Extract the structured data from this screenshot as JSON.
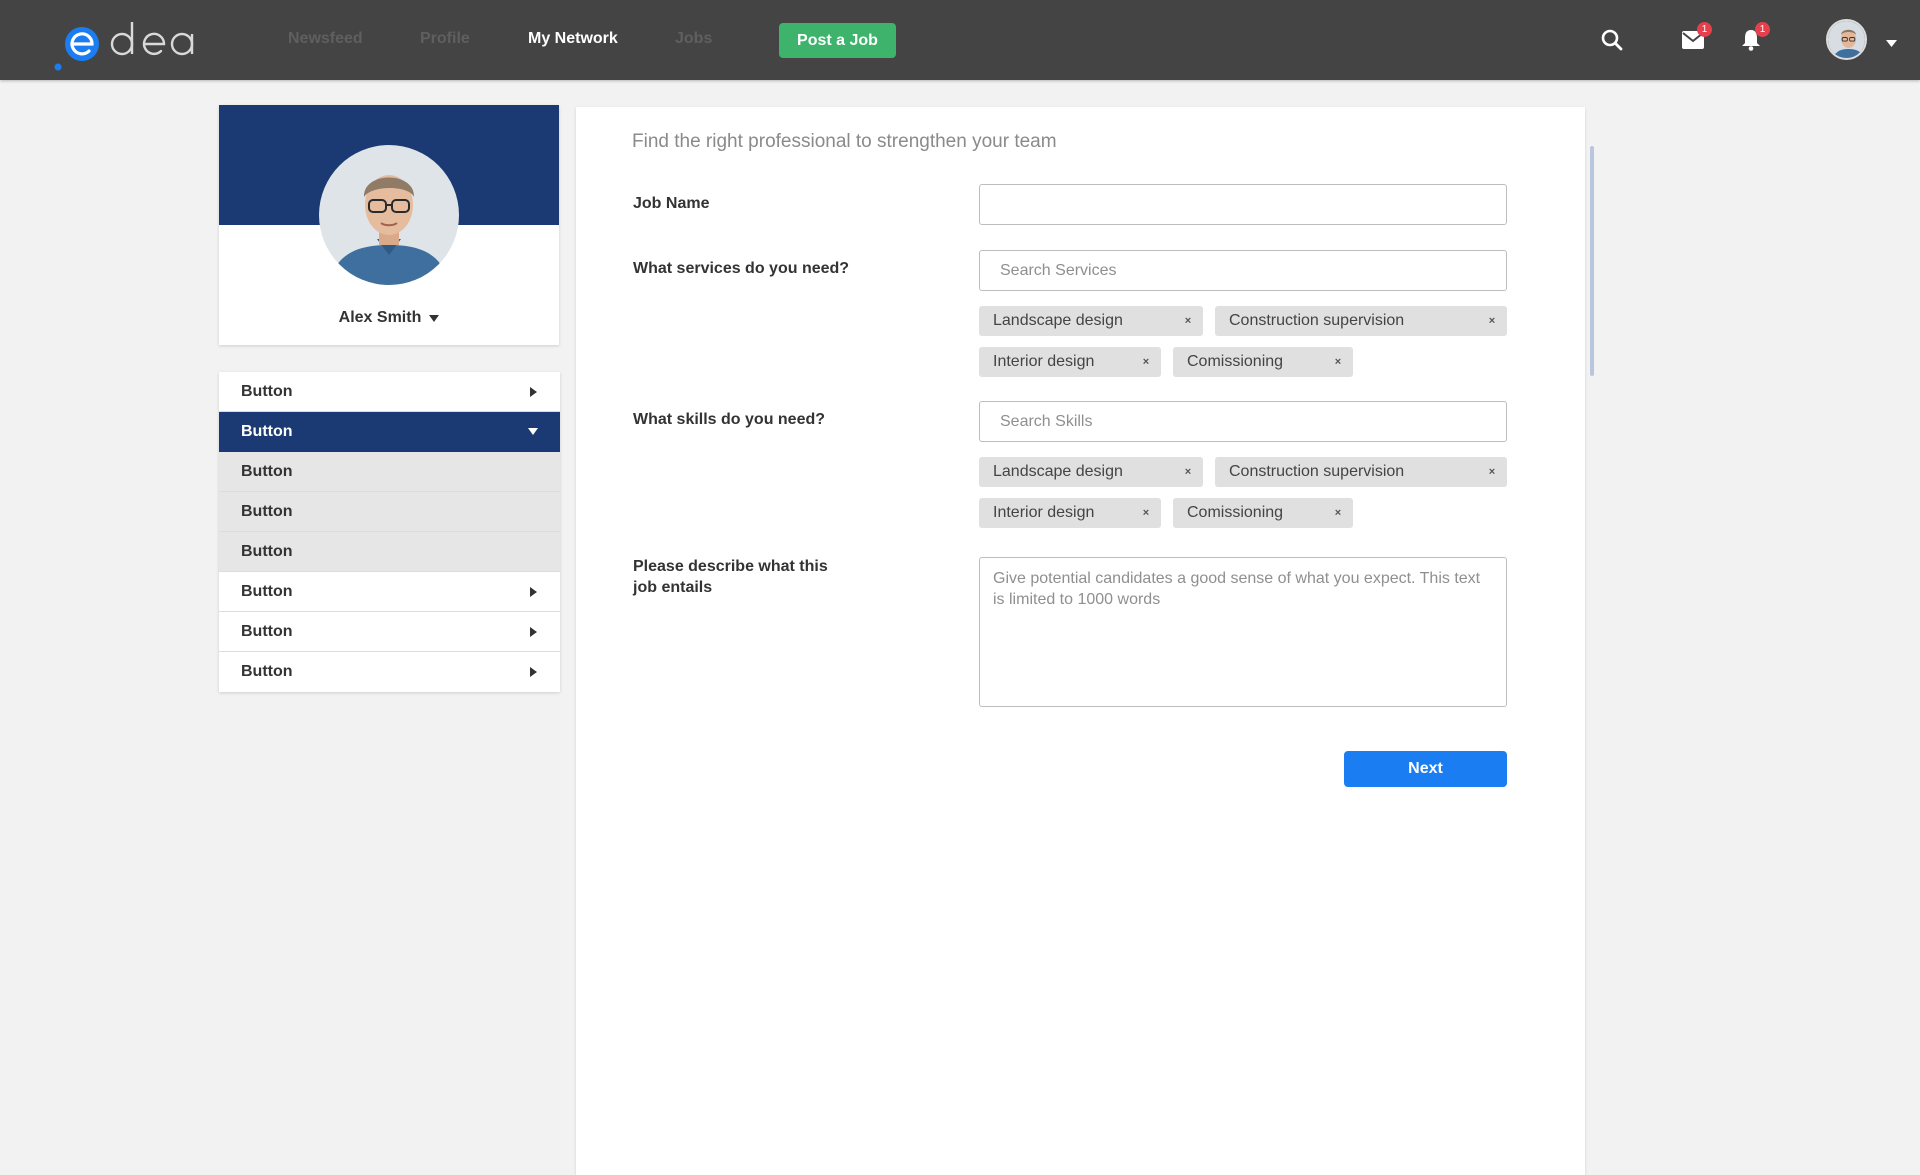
{
  "brand": {
    "logo_text": "edea",
    "accent": "#1a7ef2"
  },
  "nav": {
    "items": [
      {
        "label": "Newsfeed",
        "active": false
      },
      {
        "label": "Profile",
        "active": false
      },
      {
        "label": "My Network",
        "active": true
      },
      {
        "label": "Jobs",
        "active": false
      }
    ],
    "post_job_label": "Post a Job",
    "post_job_color": "#3db36c"
  },
  "header_icons": {
    "search_icon": "search-icon",
    "mail_icon": "mail-icon",
    "mail_badge": "1",
    "bell_icon": "bell-icon",
    "bell_badge": "1",
    "avatar": "user-avatar"
  },
  "profile": {
    "name": "Alex Smith",
    "banner_color": "#1b3a73"
  },
  "side_menu": {
    "items": [
      {
        "label": "Button",
        "state": "collapsed"
      },
      {
        "label": "Button",
        "state": "expanded"
      },
      {
        "label": "Button",
        "state": "sub"
      },
      {
        "label": "Button",
        "state": "sub"
      },
      {
        "label": "Button",
        "state": "sub"
      },
      {
        "label": "Button",
        "state": "collapsed"
      },
      {
        "label": "Button",
        "state": "collapsed"
      },
      {
        "label": "Button",
        "state": "collapsed"
      }
    ]
  },
  "form": {
    "title": "Find the right professional to strengthen your team",
    "job_name": {
      "label": "Job Name",
      "value": "",
      "placeholder": ""
    },
    "services": {
      "label": "What services do you need?",
      "placeholder": "Search Services",
      "tags": [
        "Landscape design",
        "Construction supervision",
        "Interior design",
        "Comissioning"
      ]
    },
    "skills": {
      "label": "What skills do you need?",
      "placeholder": "Search Skills",
      "tags": [
        "Landscape design",
        "Construction supervision",
        "Interior design",
        "Comissioning"
      ]
    },
    "description": {
      "label_line1": "Please describe what this",
      "label_line2": "job entails",
      "placeholder": "Give potential candidates a good sense of what you expect. This text is limited to 1000 words"
    },
    "tag_remove_symbol": "×",
    "next_label": "Next"
  }
}
